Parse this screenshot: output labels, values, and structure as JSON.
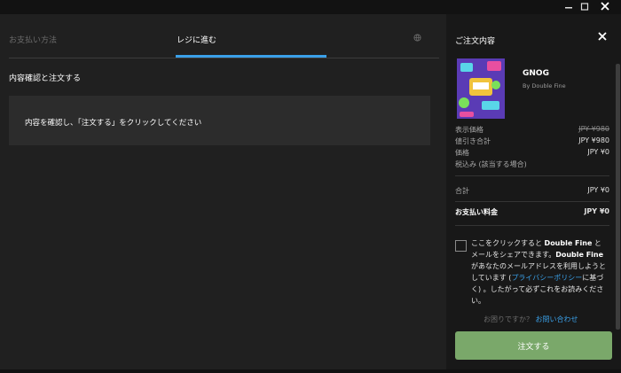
{
  "window": {
    "minimize_icon": "minimize-icon",
    "maximize_icon": "maximize-icon",
    "close_icon": "close-icon"
  },
  "tabs": {
    "payment_method": "お支払い方法",
    "checkout": "レジに進む"
  },
  "main": {
    "section_title": "内容確認と注文する",
    "instruction": "内容を確認し、「注文する」をクリックしてください"
  },
  "order": {
    "title": "ご注文内容",
    "product": {
      "name": "GNOG",
      "publisher": "By Double Fine"
    },
    "rows": {
      "display_price_label": "表示価格",
      "display_price_value": "JPY ¥980",
      "discount_label": "値引き合計",
      "discount_value": "JPY ¥980",
      "price_label": "価格",
      "price_value": "JPY ¥0",
      "tax_label": "税込み (該当する場合)",
      "subtotal_label": "合計",
      "subtotal_value": "JPY ¥0",
      "total_label": "お支払い料金",
      "total_value": "JPY ¥0"
    },
    "share": {
      "part1": "ここをクリックすると ",
      "company1": "Double Fine",
      "part2": " と メールをシェアできます。",
      "company2": "Double Fine",
      "part3": " があなたのメールアドレスを利用しようとしています (",
      "privacy_link": "プライバシーポリシー",
      "part4": "に基づく) 。したがって必ずこれをお読みください。"
    },
    "help_text": "お困りですか？",
    "help_link": "お問い合わせ",
    "order_button": "注文する"
  },
  "colors": {
    "accent": "#3aa0e8",
    "order_button": "#7aa86a",
    "panel": "#181818",
    "background": "#202020"
  }
}
